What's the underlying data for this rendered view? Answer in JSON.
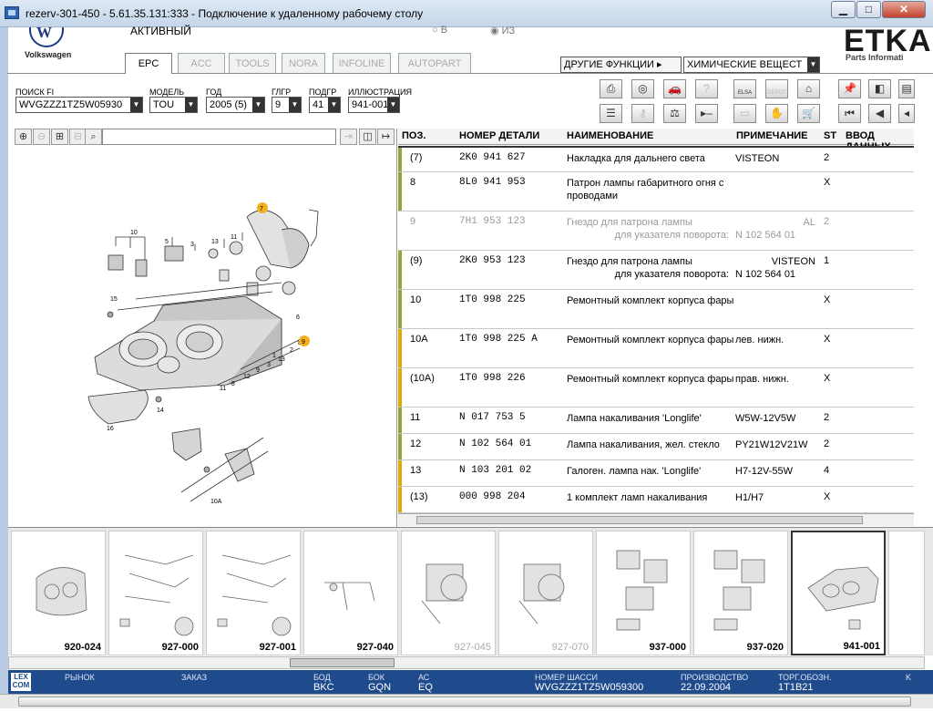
{
  "window": {
    "title": "rezerv-301-450 - 5.61.35.131:333 - Подключение к удаленному рабочему столу",
    "min": "▁",
    "max": "□",
    "close": "✕"
  },
  "brand": {
    "vw_text": "Volkswagen",
    "vw_mark": "W",
    "etka": "ETKA",
    "etka_sub": "Parts Informati"
  },
  "header": {
    "status": "АКТИВНЫЙ",
    "radio_v": "○ В",
    "radio_iz": "◉ ИЗ"
  },
  "tabs": [
    "EPC",
    "ACC",
    "TOOLS",
    "NORA",
    "INFOLINE",
    "AUTOPART"
  ],
  "other_functions": {
    "label": "ДРУГИЕ ФУНКЦИИ ▸",
    "value": "ХИМИЧЕСКИЕ ВЕЩЕСТ"
  },
  "filters": {
    "search_label": "ПОИСК FI",
    "search_value": "WVGZZZ1TZ5W05930",
    "model_label": "МОДЕЛЬ",
    "model_value": "TOU",
    "year_label": "ГОД",
    "year_value": "2005 (5)",
    "hg_label": "ГЛГР",
    "hg_value": "9",
    "ug_label": "ПОДГР",
    "ug_value": "41",
    "illus_label": "ИЛЛЮСТРАЦИЯ",
    "illus_value": "941-001"
  },
  "toolbar_icons": [
    "printer-icon",
    "tire-icon",
    "car-icon",
    "search-help-icon",
    "elsa-icon",
    "depot-icon",
    "cart-icon",
    "pin-icon",
    "prev-page-icon",
    "page-icon",
    "list-icon",
    "key-icon",
    "scale-icon",
    "play-minus-icon",
    "card-icon",
    "hands-icon",
    "cart-add-icon",
    "first-icon",
    "prev-icon",
    "back-icon"
  ],
  "toolbar_text": {
    "elsa": "ELSA",
    "depot": "DEPOT"
  },
  "image_tools": [
    "⊕",
    "⊖",
    "⊞",
    "⊟",
    "🔍"
  ],
  "table": {
    "headers": {
      "pos": "ПОЗ.",
      "part": "НОМЕР ДЕТАЛИ",
      "name": "НАИМЕНОВАНИЕ",
      "note": "ПРИМЕЧАНИЕ",
      "st": "ST",
      "data": "ВВОД ДАННЫХ"
    },
    "rows": [
      {
        "pos": "(7)",
        "part": "2K0  941  627",
        "name": "Накладка для дальнего света",
        "note": "VISTEON",
        "st": "2",
        "bar": "#8fa83a"
      },
      {
        "pos": "8",
        "part": "8L0  941  953",
        "name": "Патрон лампы габаритного огня с проводами",
        "note": "",
        "st": "X",
        "bar": "#8fa83a"
      },
      {
        "pos": "9",
        "part": "7H1  953  123",
        "name": "Гнездо для патрона лампы",
        "name2": "для указателя поворота:",
        "note": "AL",
        "note2": "N   102 564 01",
        "st": "2",
        "bar": "",
        "grey": true
      },
      {
        "pos": "(9)",
        "part": "2K0  953  123",
        "name": "Гнездо для патрона лампы",
        "name2": "для указателя поворота:",
        "note": "VISTEON",
        "note2": "N   102 564 01",
        "st": "1",
        "bar": "#8fa83a"
      },
      {
        "pos": "10",
        "part": "1T0  998  225",
        "name": "Ремонтный комплект корпуса фары",
        "note": "",
        "st": "X",
        "bar": "#8fa83a"
      },
      {
        "pos": "10A",
        "part": "1T0  998  225  A",
        "name": "Ремонтный комплект корпуса фары",
        "note": "лев. нижн.",
        "st": "X",
        "bar": "#e0a800"
      },
      {
        "pos": "(10A)",
        "part": "1T0  998  226",
        "name": "Ремонтный комплект корпуса фары",
        "note": "прав. нижн.",
        "st": "X",
        "bar": "#e0a800"
      },
      {
        "pos": "11",
        "part": "N    017  753  5",
        "name": "Лампа накаливания 'Longlife'",
        "note": "W5W-12V5W",
        "st": "2",
        "bar": "#8fa83a"
      },
      {
        "pos": "12",
        "part": "N    102  564  01",
        "name": "Лампа накаливания, жел. стекло",
        "note": "PY21W12V21W",
        "st": "2",
        "bar": "#8fa83a"
      },
      {
        "pos": "13",
        "part": "N    103  201  02",
        "name": "Галоген. лампа нак. 'Longlife'",
        "note": "H7-12V-55W",
        "st": "4",
        "bar": "#e0a800"
      },
      {
        "pos": "(13)",
        "part": "000  998  204",
        "name": "1 комплект ламп накаливания",
        "note": "H1/H7",
        "st": "X",
        "bar": "#e0a800"
      }
    ]
  },
  "diagram_labels": [
    "10",
    "5",
    "13",
    "11",
    "3",
    "12",
    "7",
    "8",
    "15",
    "9",
    "2",
    "1",
    "4",
    "6",
    "16",
    "14",
    "10A",
    "2",
    "8",
    "9",
    "1"
  ],
  "thumbnails": [
    {
      "cap": "920-024",
      "grey": false
    },
    {
      "cap": "927-000",
      "grey": false
    },
    {
      "cap": "927-001",
      "grey": false
    },
    {
      "cap": "927-040",
      "grey": false
    },
    {
      "cap": "927-045",
      "grey": true
    },
    {
      "cap": "927-070",
      "grey": true
    },
    {
      "cap": "937-000",
      "grey": false
    },
    {
      "cap": "937-020",
      "grey": false
    },
    {
      "cap": "941-001",
      "grey": false,
      "sel": true
    }
  ],
  "status": {
    "logo": "LEX COM",
    "market_k": "РЫНОК",
    "market_v": "",
    "order_k": "ЗАКАЗ",
    "order_v": "",
    "bod_k": "БОД",
    "bod_v": "BKC",
    "box_k": "БОК",
    "box_v": "GQN",
    "ac_k": "АС",
    "ac_v": "EQ",
    "chassis_k": "НОМЕР ШАССИ",
    "chassis_v": "WVGZZZ1TZ5W059300",
    "prod_k": "ПРОИЗВОДСТВО",
    "prod_v": "22.09.2004",
    "trade_k": "ТОРГ.ОБОЗН.",
    "trade_v": "1T1B21",
    "k_k": "K"
  },
  "colors": {
    "status_bg": "#1f4a8c",
    "bar_green": "#8fa83a",
    "bar_yellow": "#e0a800",
    "badge": "#f2b01e"
  }
}
